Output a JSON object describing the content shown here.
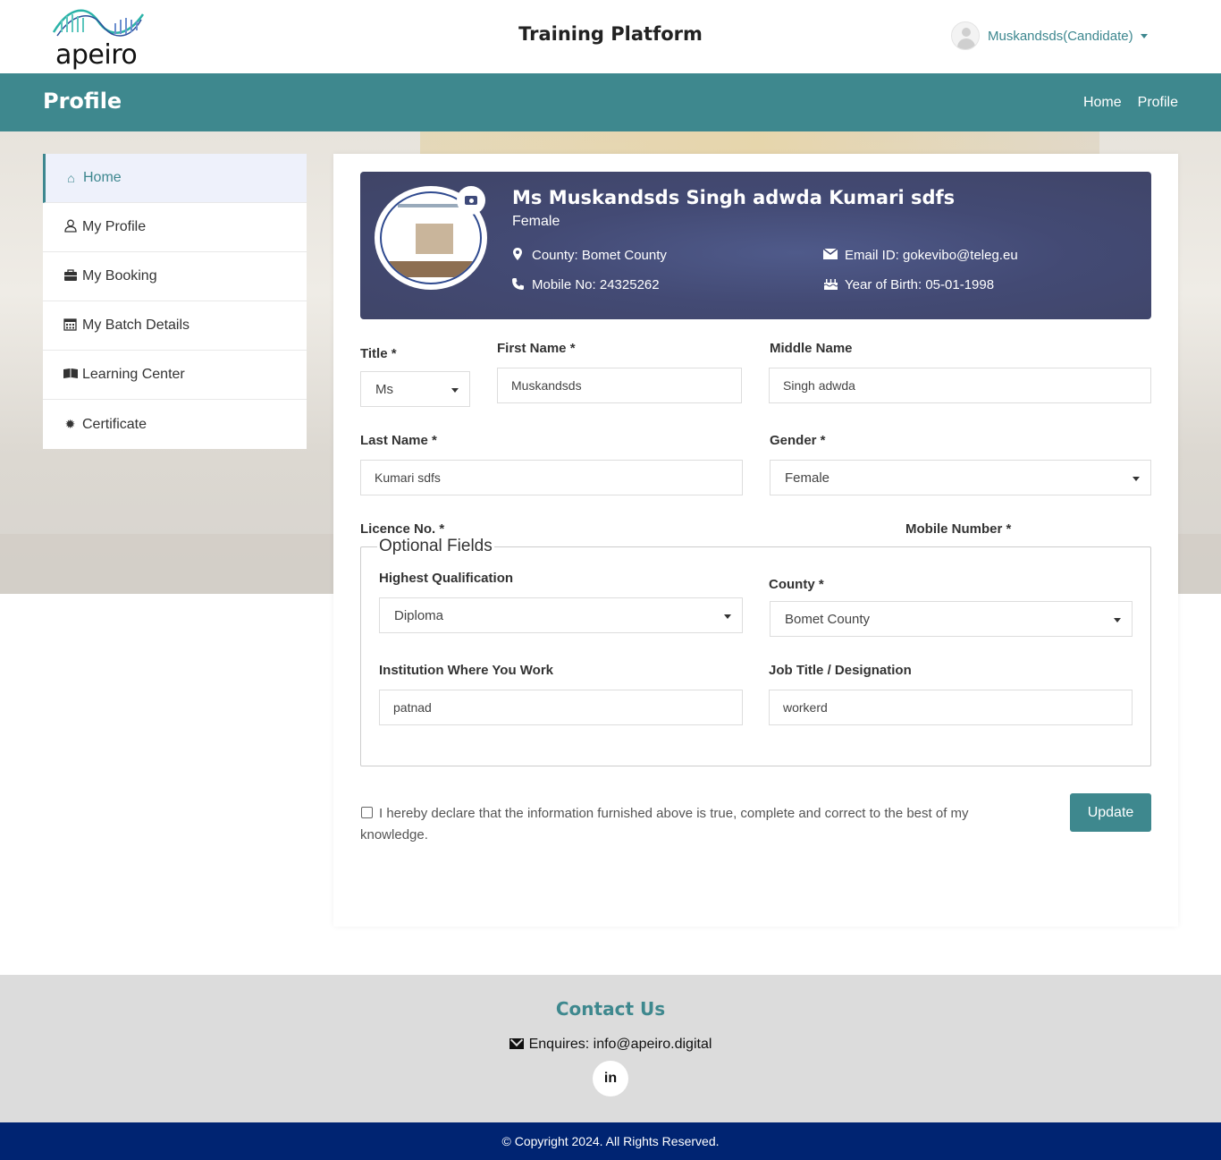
{
  "header": {
    "logo_text": "apeiro",
    "app_title": "Training Platform",
    "user_name": "Muskandsds(Candidate)"
  },
  "titlebar": {
    "title": "Profile",
    "breadcrumbs": [
      "Home",
      "Profile"
    ]
  },
  "sidebar": {
    "items": [
      {
        "label": "Home",
        "icon": "home-icon",
        "active": true
      },
      {
        "label": "My Profile",
        "icon": "user-icon"
      },
      {
        "label": "My Booking",
        "icon": "briefcase-icon"
      },
      {
        "label": "My Batch Details",
        "icon": "calendar-icon"
      },
      {
        "label": "Learning Center",
        "icon": "book-icon"
      },
      {
        "label": "Certificate",
        "icon": "certificate-icon"
      }
    ]
  },
  "profile": {
    "full_name": "Ms Muskandsds Singh adwda Kumari sdfs",
    "gender": "Female",
    "county": "County: Bomet County",
    "mobile": "Mobile No: 24325262",
    "email": "Email ID: gokevibo@teleg.eu",
    "yob": "Year of Birth: 05-01-1998"
  },
  "form": {
    "title_label": "Title *",
    "title_value": "Ms",
    "first_name_label": "First Name *",
    "first_name_value": "Muskandsds",
    "middle_name_label": "Middle Name",
    "middle_name_value": "Singh adwda",
    "last_name_label": "Last Name *",
    "last_name_value": "Kumari sdfs",
    "gender_label": "Gender *",
    "gender_value": "Female",
    "licence_label": "Licence No. *",
    "mobile_label": "Mobile Number *",
    "optional_legend": "Optional Fields",
    "qualification_label": "Highest Qualification",
    "qualification_value": "Diploma",
    "county_label": "County *",
    "county_value": "Bomet County",
    "institution_label": "Institution Where You Work",
    "institution_value": "patnad",
    "job_title_label": "Job Title / Designation",
    "job_title_value": "workerd",
    "declaration": "I hereby declare that the information furnished above is true, complete and correct to the best of my knowledge.",
    "update_label": "Update"
  },
  "footer": {
    "contact_title": "Contact Us",
    "enquiries": "Enquires: info@apeiro.digital",
    "linkedin_label": "in",
    "copyright": "© Copyright 2024. All Rights Reserved."
  },
  "colors": {
    "primary": "#3e888e",
    "banner": "#434a74",
    "copyright_bar": "#002472",
    "footer_bg": "#dcdcdc"
  }
}
